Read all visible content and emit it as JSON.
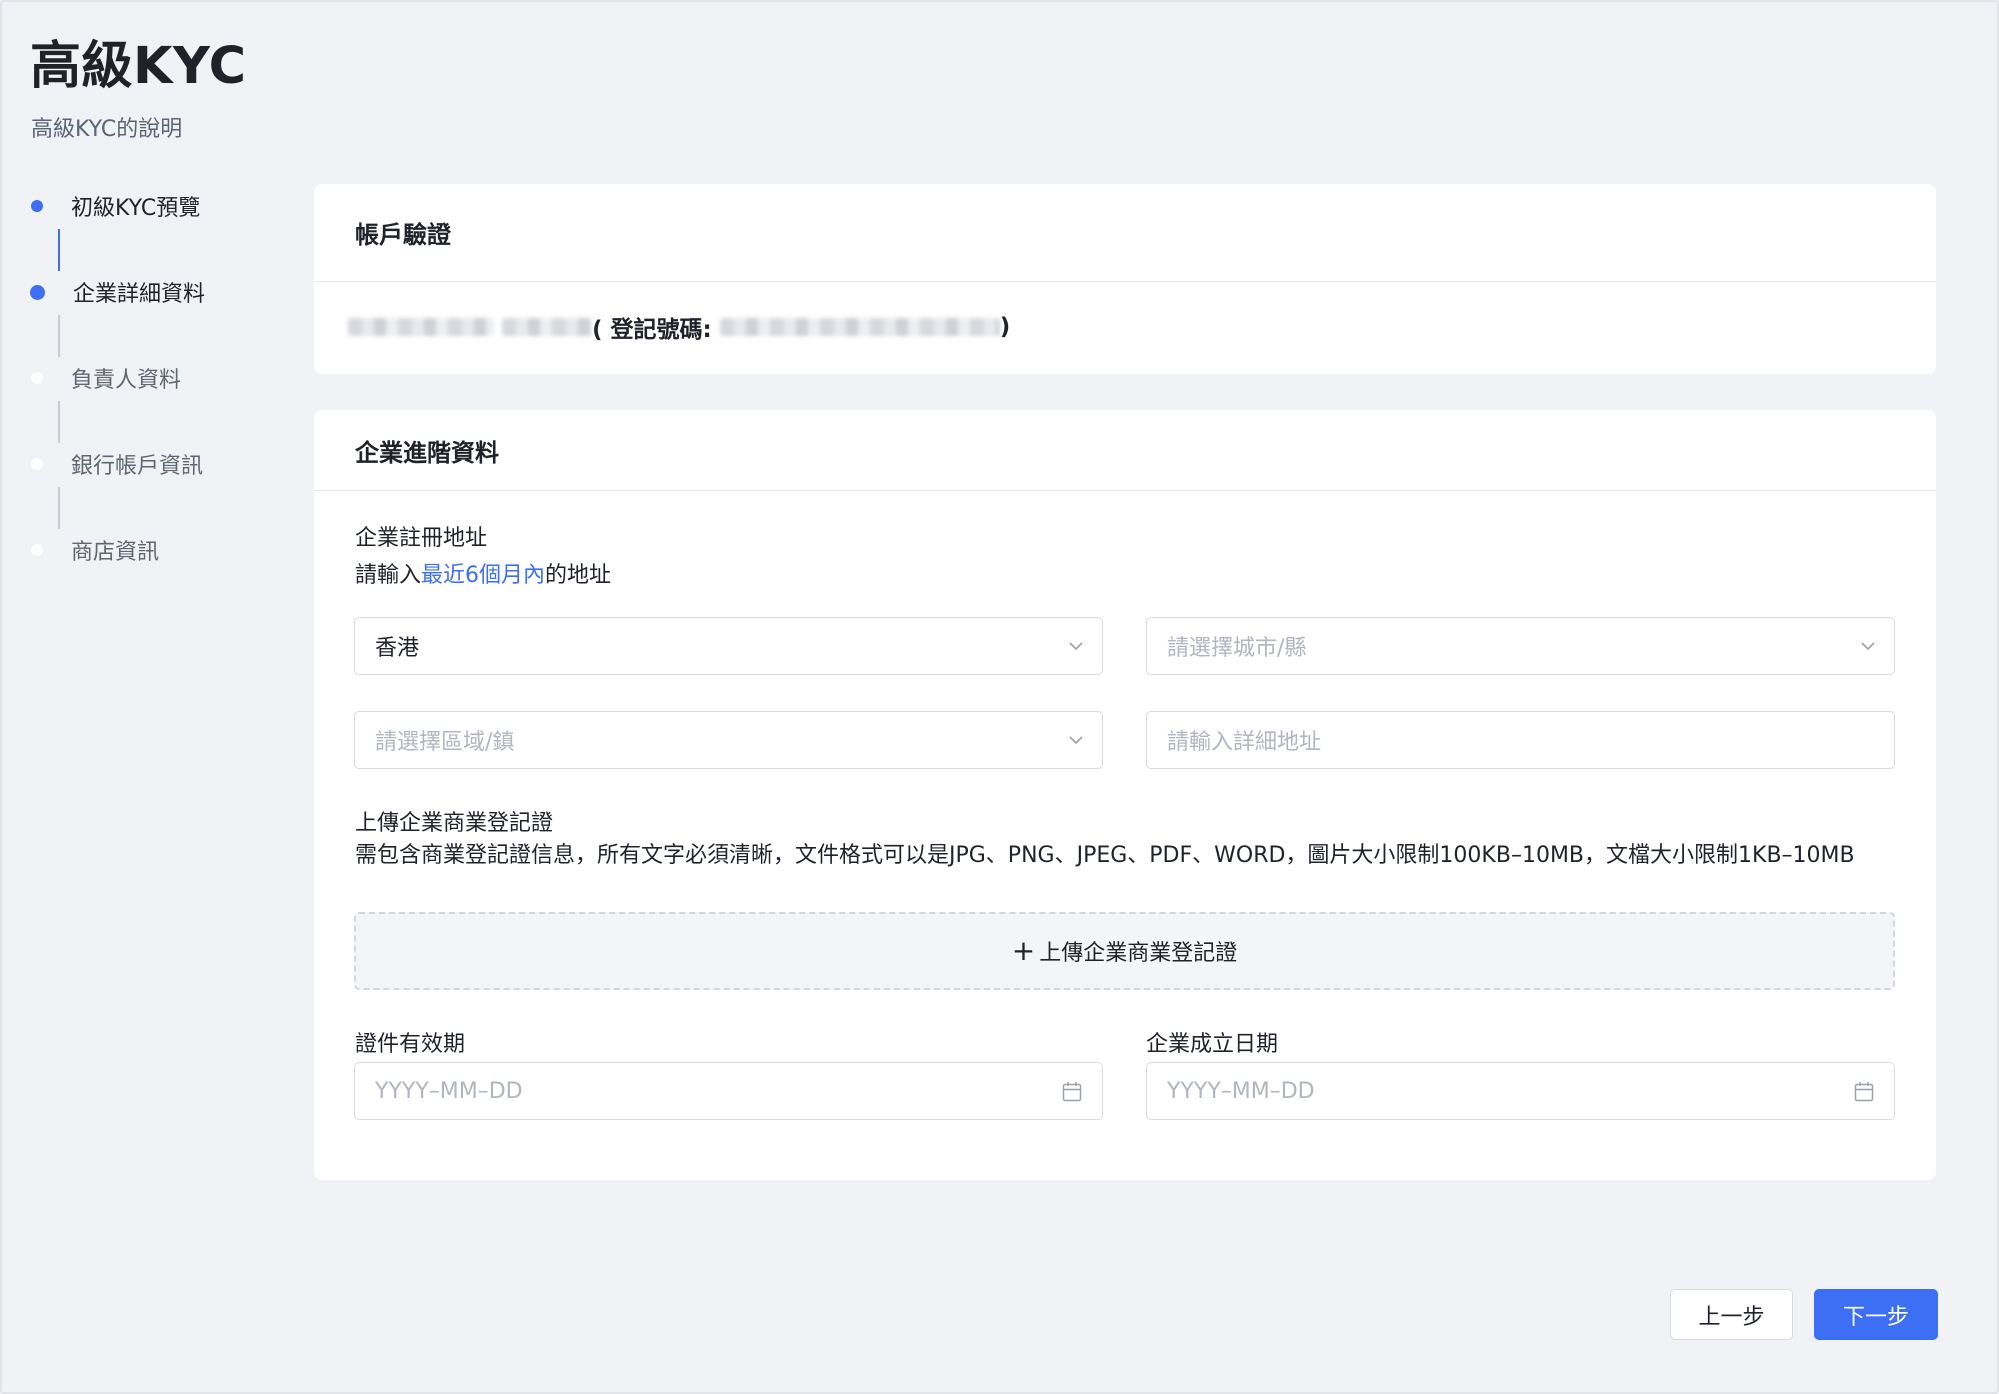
{
  "page": {
    "title": "高級KYC",
    "subtitle": "高級KYC的說明"
  },
  "steps": [
    {
      "label": "初級KYC預覽",
      "status": "done"
    },
    {
      "label": "企業詳細資料",
      "status": "current"
    },
    {
      "label": "負責人資料",
      "status": "pending"
    },
    {
      "label": "銀行帳戶資訊",
      "status": "pending"
    },
    {
      "label": "商店資訊",
      "status": "pending"
    }
  ],
  "account_card": {
    "title": "帳戶驗證",
    "registration_prefix": "( 登記號碼:",
    "registration_suffix": ")"
  },
  "advanced_card": {
    "title": "企業進階資料",
    "address": {
      "title": "企業註冊地址",
      "hint_before": "請輸入",
      "hint_accent": "最近6個月內",
      "hint_after": "的地址",
      "country_value": "香港",
      "city_placeholder": "請選擇城市/縣",
      "district_placeholder": "請選擇區域/鎮",
      "detail_placeholder": "請輸入詳細地址"
    },
    "upload": {
      "title": "上傳企業商業登記證",
      "description": "需包含商業登記證信息，所有文字必須清晰，文件格式可以是JPG、PNG、JPEG、PDF、WORD，圖片大小限制100KB–10MB，文檔大小限制1KB–10MB",
      "button_plus": "+",
      "button_label": "上傳企業商業登記證"
    },
    "validity": {
      "title": "證件有效期",
      "placeholder": "YYYY–MM–DD"
    },
    "established": {
      "title": "企業成立日期",
      "placeholder": "YYYY–MM–DD"
    }
  },
  "footer": {
    "prev_label": "上一步",
    "next_label": "下一步"
  },
  "colors": {
    "accent": "#3d6ff5",
    "background": "#f0f2f6",
    "card": "#ffffff"
  },
  "icons": {
    "select_arrow": "chevron-down-icon",
    "date_picker": "calendar-icon"
  }
}
